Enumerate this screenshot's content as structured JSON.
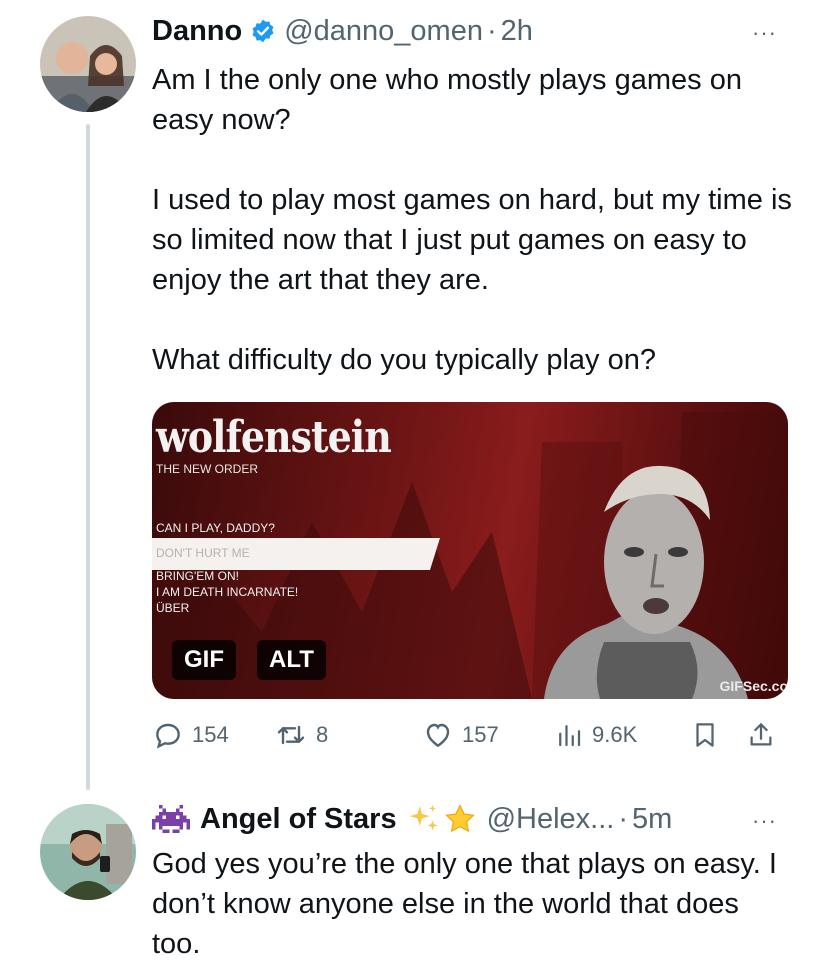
{
  "tweet1": {
    "display_name": "Danno",
    "handle": "@danno_omen",
    "separator": "·",
    "time": "2h",
    "more": "···",
    "text": "Am I the only one who mostly plays games on easy now?\n\nI used to play most games on hard, but my time is so limited now that I just put games on easy to enjoy the art that they are.\n\nWhat difficulty do you typically play on?",
    "media": {
      "game_title": "wolfenstein",
      "subtitle": "THE NEW ORDER",
      "menu": [
        "CAN I PLAY, DADDY?",
        "DON'T HURT ME",
        "BRING'EM ON!",
        "I AM DEATH INCARNATE!",
        "ÜBER"
      ],
      "selected_index": 1,
      "gif_label": "GIF",
      "alt_label": "ALT",
      "watermark": "GIFSec.co"
    },
    "actions": {
      "replies": "154",
      "retweets": "8",
      "likes": "157",
      "views": "9.6K"
    },
    "colors": {
      "verified": "#1d9bf0",
      "secondary": "#536471"
    }
  },
  "tweet2": {
    "display_name": "Angel of Stars",
    "handle": "@Helex...",
    "separator": "·",
    "time": "5m",
    "more": "···",
    "text": "God yes you’re the only one that plays on easy. I don’t know anyone else in the world that does too."
  }
}
